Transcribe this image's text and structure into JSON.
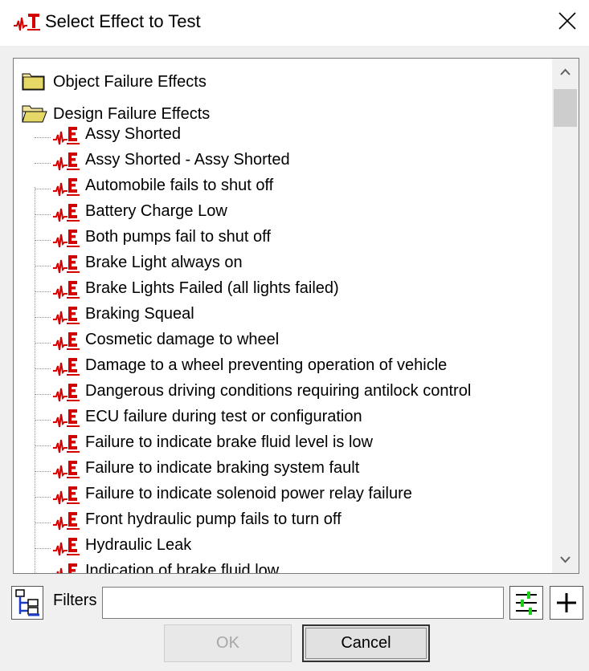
{
  "window": {
    "title": "Select Effect to Test",
    "icon": "tester-logo-icon",
    "close_icon": "close-icon"
  },
  "tree": {
    "groups": [
      {
        "label": "Object Failure Effects",
        "icon": "folder-closed-icon",
        "expanded": false
      },
      {
        "label": "Design Failure Effects",
        "icon": "folder-open-icon",
        "expanded": true
      }
    ],
    "items": [
      "Assy Shorted",
      "Assy Shorted - Assy Shorted",
      "Automobile fails to shut off",
      "Battery Charge Low",
      "Both pumps fail to shut off",
      "Brake Light always on",
      "Brake Lights Failed (all lights failed)",
      "Braking Squeal",
      "Cosmetic damage to wheel",
      "Damage to a wheel preventing operation of vehicle",
      "Dangerous driving conditions requiring antilock control",
      "ECU failure during test or configuration",
      "Failure to indicate brake fluid level is low",
      "Failure to indicate braking system fault",
      "Failure to indicate solenoid power relay failure",
      "Front hydraulic pump fails to turn off",
      "Hydraulic Leak",
      "Indication of brake fluid low"
    ],
    "item_icon": "effect-icon",
    "effect_icon_color": "#d40000"
  },
  "filters": {
    "label": "Filters",
    "value": "",
    "placeholder": ""
  },
  "buttons": {
    "ok": "OK",
    "cancel": "Cancel"
  }
}
